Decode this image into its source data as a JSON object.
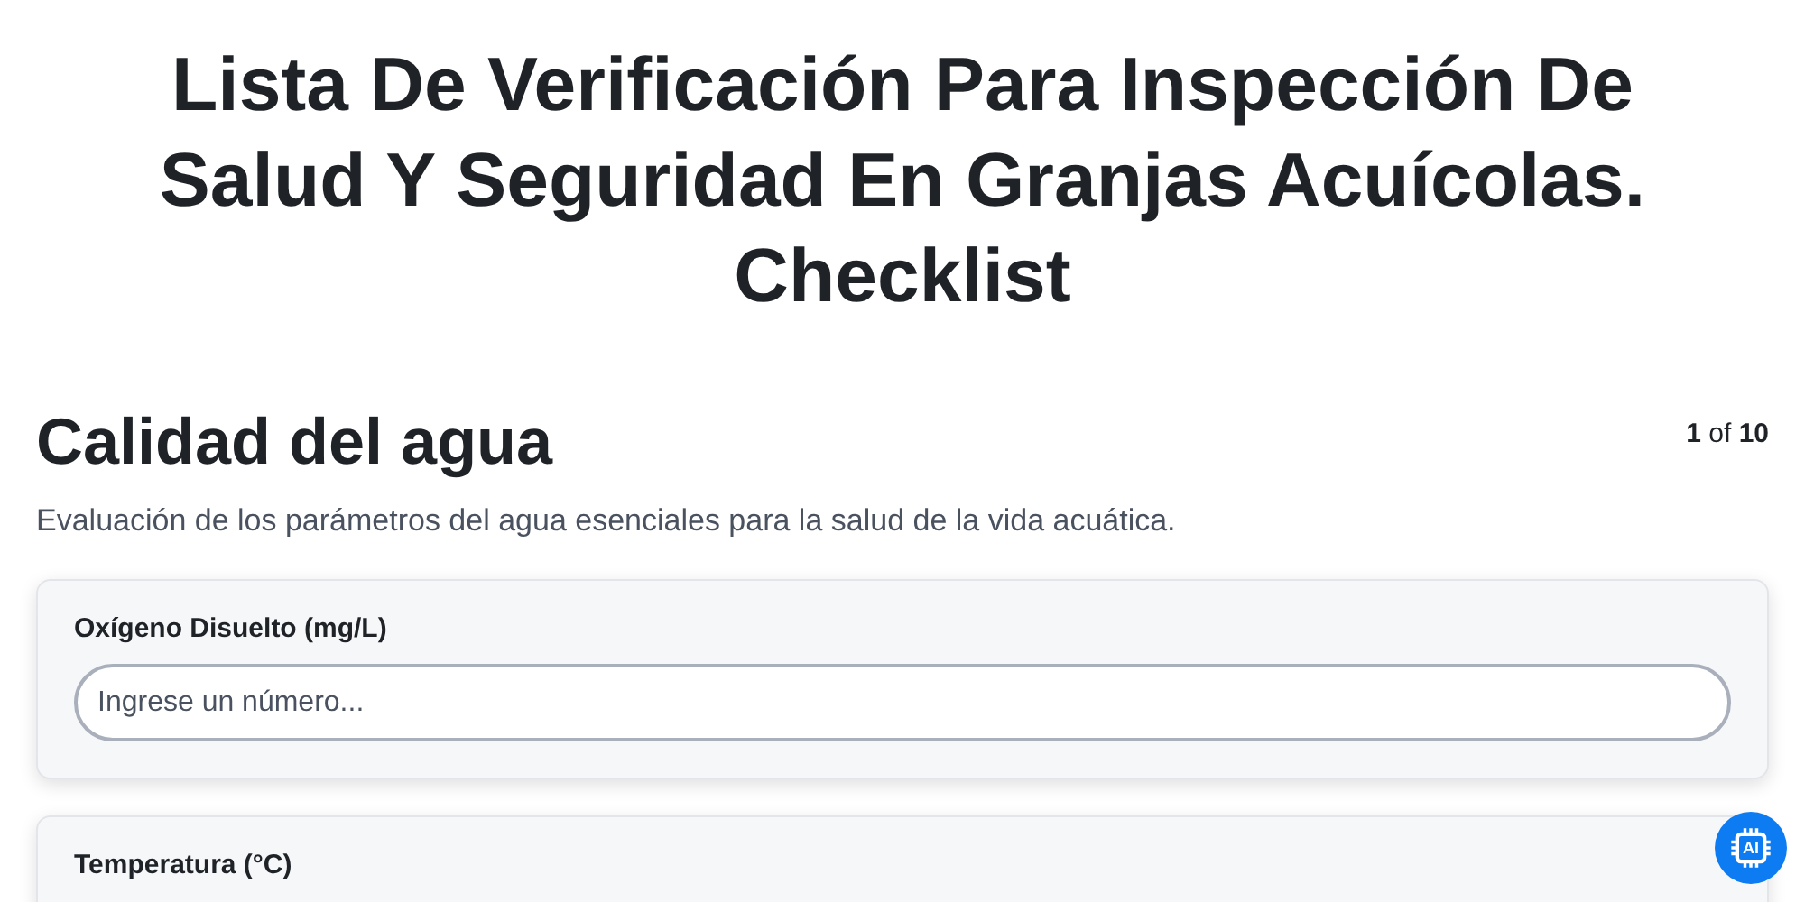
{
  "title": "Lista De Verificación Para Inspección De Salud Y Seguridad En Granjas Acuícolas. Checklist",
  "section": {
    "heading": "Calidad del agua",
    "progress": "**1** of **10**",
    "description": "Evaluación de los parámetros del agua esenciales para la salud de la vida acuática."
  },
  "questions": [
    {
      "label": "Oxígeno Disuelto (mg/L)",
      "kind": "number",
      "placeholder": "Ingrese un número..."
    },
    {
      "label": "Temperatura (°C)",
      "kind": "label-only"
    }
  ],
  "ai_button": {
    "label": "AI"
  }
}
